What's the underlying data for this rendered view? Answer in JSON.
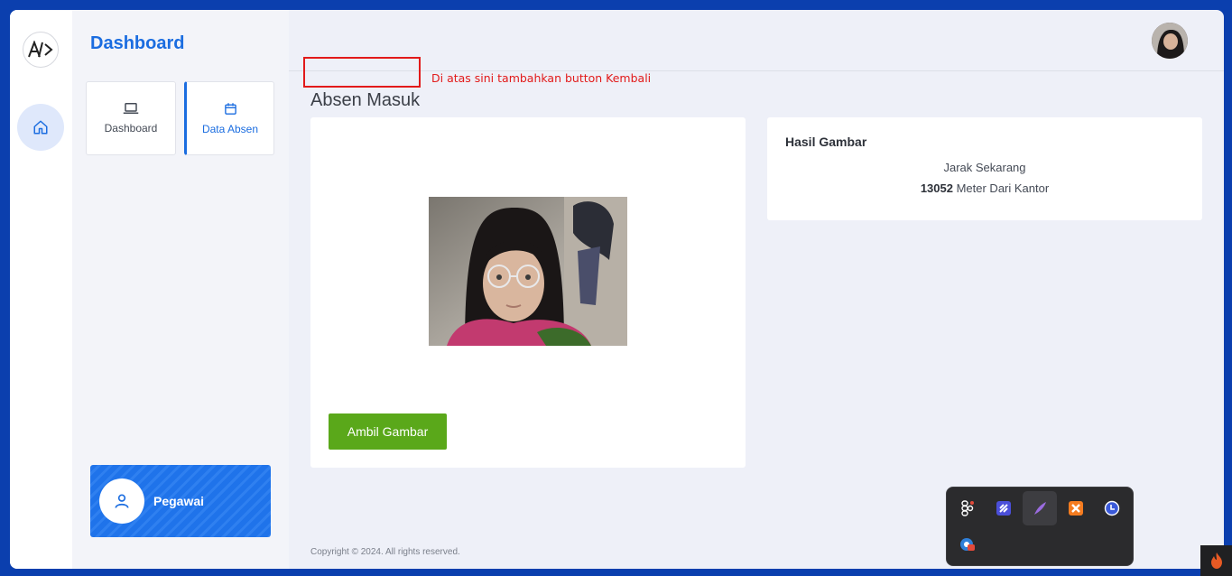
{
  "sidebar": {
    "title": "Dashboard",
    "tiles": [
      {
        "label": "Dashboard",
        "icon": "laptop-icon"
      },
      {
        "label": "Data Absen",
        "icon": "calendar-icon"
      }
    ],
    "user": {
      "name": "Pegawai",
      "icon": "user-icon"
    }
  },
  "annotation": {
    "text": "Di atas sini tambahkan button Kembali"
  },
  "page": {
    "title": "Absen Masuk"
  },
  "camera": {
    "button_label": "Ambil Gambar"
  },
  "result": {
    "title": "Hasil Gambar",
    "distance_label": "Jarak Sekarang",
    "distance_value": "13052",
    "distance_unit": "Meter Dari Kantor"
  },
  "footer": {
    "text": "Copyright © 2024. All rights reserved."
  },
  "tray": {
    "icons": [
      "figma-icon",
      "linear-icon",
      "feather-icon",
      "xampp-icon",
      "clock-icon",
      "chrome-badge-icon"
    ]
  },
  "colors": {
    "accent": "#1b6de0",
    "button_green": "#5aa81a",
    "annotation_red": "#e21a1a",
    "background_frame": "#0b3fae"
  }
}
